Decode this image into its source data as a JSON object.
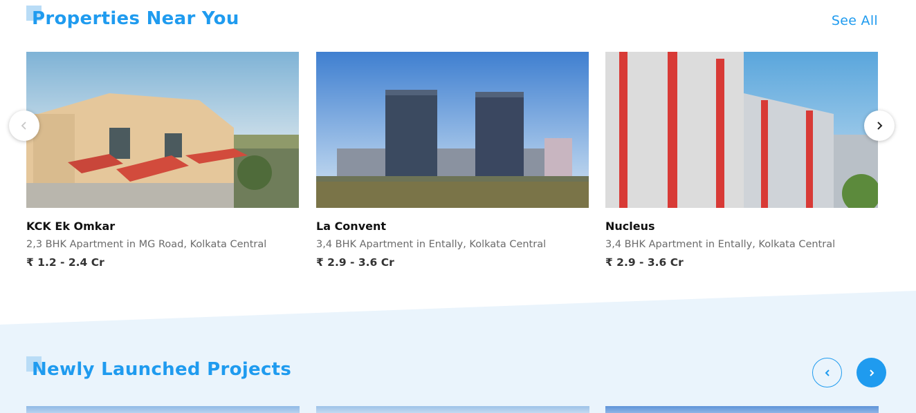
{
  "colors": {
    "accent": "#1f9bef",
    "accent_light": "#b9dcf6",
    "band": "#eaf4fc"
  },
  "properties_section": {
    "title": "Properties Near You",
    "see_all": "See All",
    "prev_icon": "chevron-left-icon",
    "next_icon": "chevron-right-icon",
    "cards": [
      {
        "name": "KCK Ek Omkar",
        "description": "2,3 BHK Apartment in MG Road, Kolkata Central",
        "price": "₹ 1.2 - 2.4 Cr"
      },
      {
        "name": "La Convent",
        "description": "3,4 BHK Apartment in Entally, Kolkata Central",
        "price": "₹ 2.9 - 3.6 Cr"
      },
      {
        "name": "Nucleus",
        "description": "3,4 BHK Apartment in Entally, Kolkata Central",
        "price": "₹ 2.9 - 3.6 Cr"
      }
    ]
  },
  "new_projects_section": {
    "title": "Newly Launched Projects",
    "prev_icon": "chevron-left-icon",
    "next_icon": "chevron-right-icon"
  }
}
